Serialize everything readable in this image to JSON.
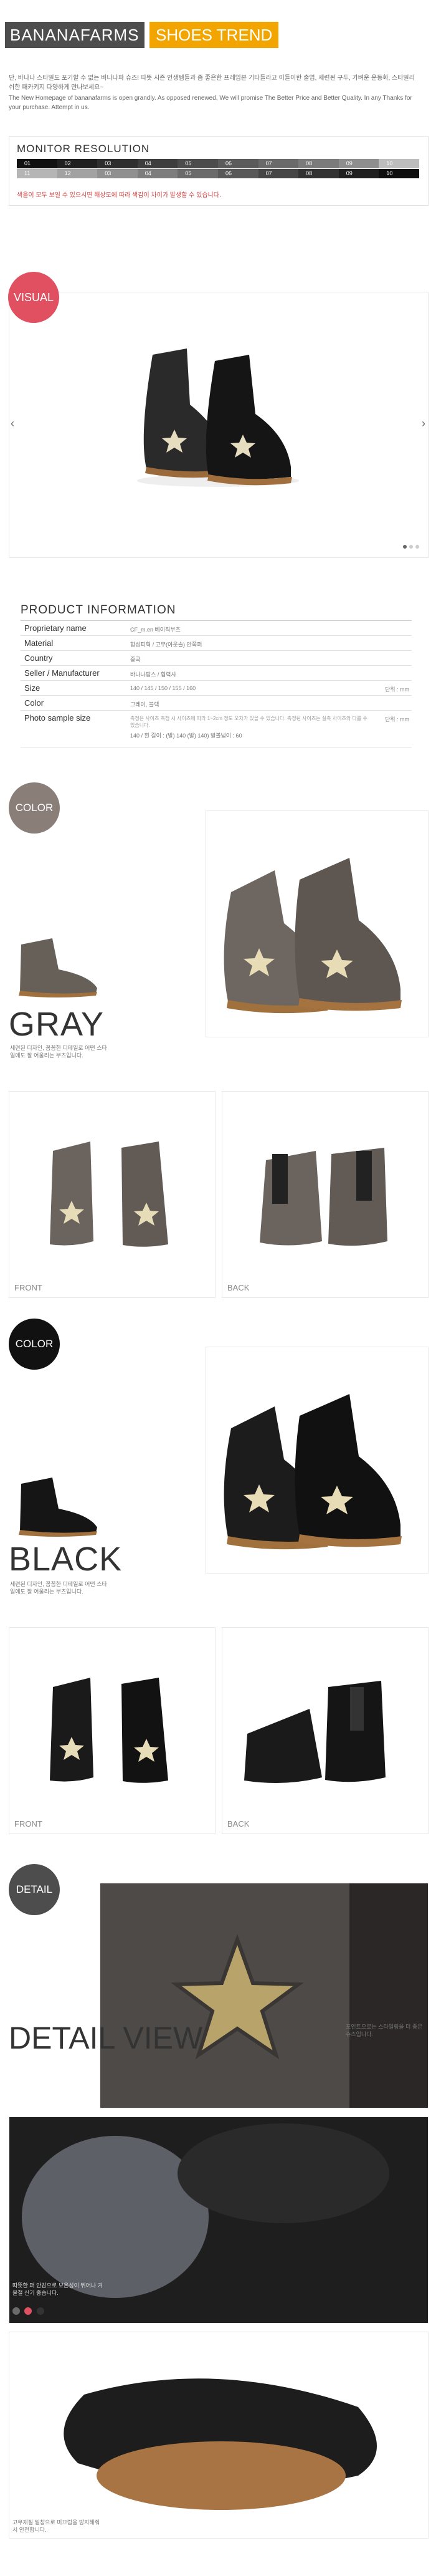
{
  "header": {
    "brand": "BANANAFARMS",
    "trend": "SHOES TREND"
  },
  "intro": {
    "ko": "단, 바나나 스타일도 포기할 수 없는 바나나파 슈즈! 따뜻 시즌 인생템들과 좀 좋은한 프레임본 기타들라고 이들이한 출업, 세련된 구두, 가벼운 운동화, 스타일리쉬한 패카키지 다양하게 만나보세요~",
    "en": "The New Homepage of bananafarms is open grandly. As opposed renewed, We will promise The Better Price and Better Quality. In any Thanks for your purchase. Attempt in us."
  },
  "monitor": {
    "title": "MONITOR RESOLUTION",
    "row1": [
      "01",
      "02",
      "03",
      "04",
      "05",
      "06",
      "07",
      "08",
      "09",
      "10"
    ],
    "row2": [
      "11",
      "12",
      "03",
      "04",
      "05",
      "06",
      "07",
      "08",
      "09",
      "10"
    ],
    "row1_colors": [
      "#111111",
      "#1f1f1f",
      "#2e2e2e",
      "#3d3d3d",
      "#4c4c4c",
      "#5b5b5b",
      "#6a6a6a",
      "#7b7b7b",
      "#8e8e8e",
      "#bdbdbd"
    ],
    "row2_colors": [
      "#b5b5b5",
      "#a2a2a2",
      "#909090",
      "#7e7e7e",
      "#6b6b6b",
      "#595959",
      "#464646",
      "#333333",
      "#202020",
      "#0e0e0e"
    ],
    "note": "색을이 모두 보일 수 있으시면 해상도에 따라 색감이 차이가 발생할 수 있습니다."
  },
  "visual": {
    "circle_label": "VISUAL",
    "left_arrow": "‹",
    "right_arrow": "›"
  },
  "product_info": {
    "title": "PRODUCT INFORMATION",
    "rows": [
      {
        "label": "Proprietary name",
        "value": "CF_m.en 베이직부츠",
        "unit": ""
      },
      {
        "label": "Material",
        "value": "합성피혁 / 고무(아웃솔) 안쪽퍼",
        "unit": ""
      },
      {
        "label": "Country",
        "value": "중국",
        "unit": ""
      },
      {
        "label": "Seller / Manufacturer",
        "value": "바나나팜스 / 협력사",
        "unit": ""
      },
      {
        "label": "Size",
        "value": "140 / 145 / 150 / 155 / 160",
        "unit": "단위 : mm"
      },
      {
        "label": "Color",
        "value": "그레이, 블랙",
        "unit": ""
      },
      {
        "label": "Photo sample size",
        "value": "140 / 흰 길이 : (발) 140 (발) 140) 발볼넓이 : 60",
        "unit": "단위 : mm"
      }
    ],
    "footnote": "측정은 사이즈 측정 시 사이즈에 따라 1~2cm 정도 오차가 있을 수 있습니다. 측정된 사이즈는 실측 사이즈와 다를 수 있습니다."
  },
  "gray": {
    "circle_label": "COLOR",
    "name": "GRAY",
    "desc": "세련된 디자인, 꼼꼼한 디테일로 어떤 스타일에도 잘 어울리는 부츠입니다.",
    "front": "FRONT",
    "back": "BACK",
    "circle_color": "#8a7e78"
  },
  "black": {
    "circle_label": "COLOR",
    "name": "BLACK",
    "desc": "세련된 디자인, 꼼꼼한 디테일로 어떤 스타일에도 잘 어울리는 부츠입니다.",
    "front": "FRONT",
    "back": "BACK",
    "circle_color": "#111111"
  },
  "detail": {
    "circle_label": "DETAIL",
    "title": "DETAIL VIEW",
    "desc1": "포인트으로는 스타일링을 더 좋은 슈즈입니다.",
    "desc2": "따뜻한 퍼 안감으로 보온성이 뛰어나 겨울철 신기 좋습니다.",
    "desc3": "고무재질 밑창으로 미끄럼을 방지해줘서 안전합니다.",
    "swatch_colors": [
      "#6b6b6b",
      "#e05060",
      "#333333"
    ]
  }
}
